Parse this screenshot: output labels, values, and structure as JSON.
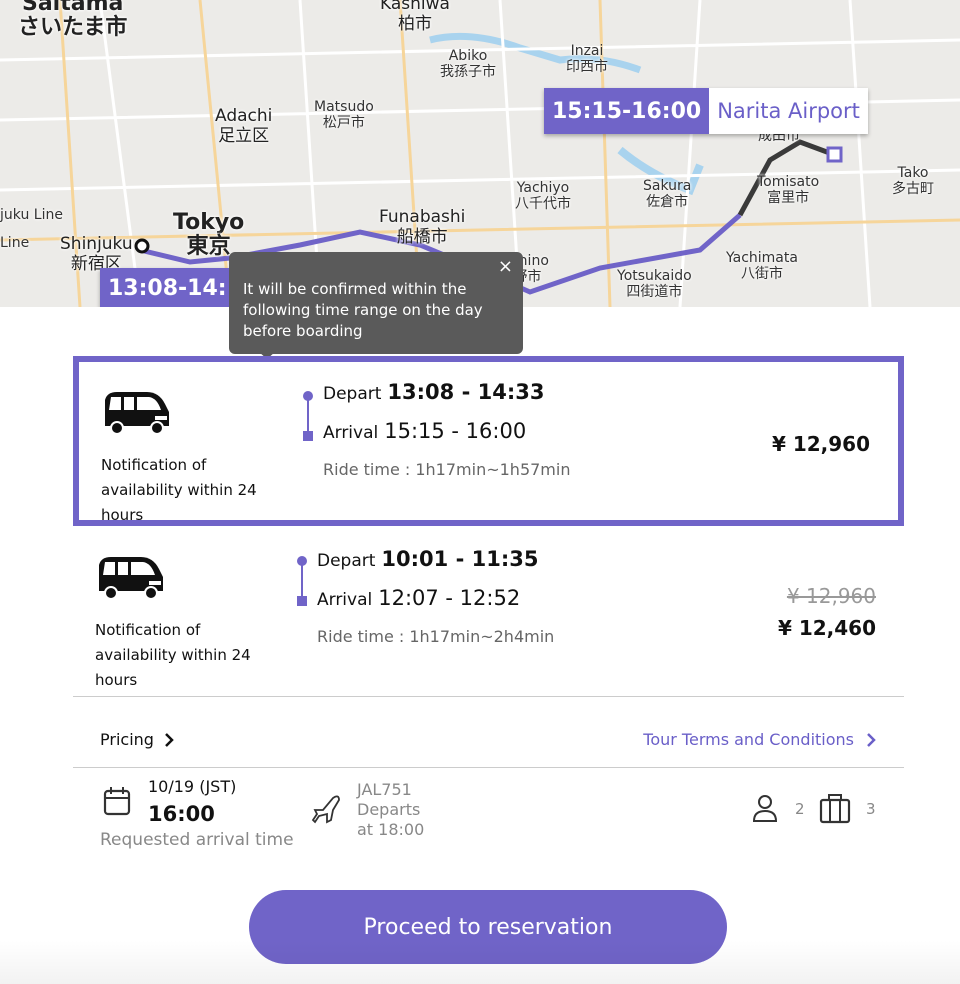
{
  "colors": {
    "accent": "#7064c8",
    "route_purple": "#7064c8",
    "route_dark": "#3a3a3a",
    "tooltip_bg": "#5a5a5a"
  },
  "map": {
    "labels": [
      {
        "en": "Saitama",
        "ja": "さいたま市"
      },
      {
        "en": "Kashiwa",
        "ja": "柏市"
      },
      {
        "en": "Abiko",
        "ja": "我孫子市"
      },
      {
        "en": "Inzai",
        "ja": "印西市"
      },
      {
        "en": "Adachi",
        "ja": "足立区"
      },
      {
        "en": "Matsudo",
        "ja": "松戸市"
      },
      {
        "en": "Tokyo",
        "ja": "東京"
      },
      {
        "en": "Shinjuku",
        "ja": "新宿区"
      },
      {
        "en": "Funabashi",
        "ja": "船橋市"
      },
      {
        "en": "Yachiyo",
        "ja": "八千代市"
      },
      {
        "en": "Sakura",
        "ja": "佐倉市"
      },
      {
        "en": "Tomisato",
        "ja": "富里市"
      },
      {
        "en": "Tako",
        "ja": "多古町"
      },
      {
        "en": "Yachimata",
        "ja": "八街市"
      },
      {
        "en": "Yotsukaido",
        "ja": "四街道市"
      },
      {
        "en": "Narashino",
        "ja": "習志野市"
      },
      {
        "en": "Line",
        "ja": ""
      },
      {
        "en": "juku Line",
        "ja": ""
      },
      {
        "en": "",
        "ja": "成田市"
      }
    ],
    "arrival_tag": {
      "time": "15:15-16:00",
      "place": "Narita Airport"
    },
    "depart_tag": {
      "time": "13:08-14:"
    }
  },
  "tooltip": {
    "text": "It will be confirmed within the following time range on the day before boarding",
    "close": "×"
  },
  "options": [
    {
      "notice": "Notification of availability within 24 hours",
      "depart_label": "Depart",
      "depart": "13:08 - 14:33",
      "arrival_label": "Arrival",
      "arrival": "15:15 - 16:00",
      "ride": "Ride time : 1h17min~1h57min",
      "price": "¥ 12,960",
      "selected": true
    },
    {
      "notice": "Notification of availability within 24 hours",
      "depart_label": "Depart",
      "depart": "10:01 - 11:35",
      "arrival_label": "Arrival",
      "arrival": "12:07 - 12:52",
      "ride": "Ride time : 1h17min~2h4min",
      "original_price": "¥ 12,960",
      "price": "¥ 12,460",
      "selected": false
    }
  ],
  "links": {
    "pricing": "Pricing",
    "terms": "Tour Terms and Conditions"
  },
  "info": {
    "date": "10/19 (JST)",
    "time": "16:00",
    "time_label": "Requested arrival time",
    "flight": "JAL751",
    "flight_dep1": "Departs",
    "flight_dep2": "at 18:00",
    "passengers": "2",
    "luggage": "3"
  },
  "cta": "Proceed to reservation"
}
